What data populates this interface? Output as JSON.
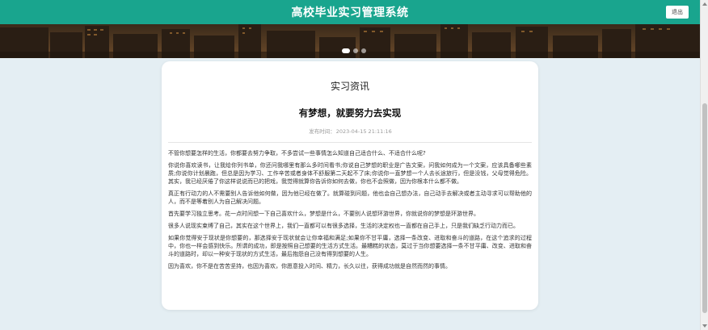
{
  "header": {
    "title": "高校毕业实习管理系统",
    "logout_label": "退出"
  },
  "section_title": "实习资讯",
  "article": {
    "title": "有梦想，就要努力去实现",
    "publish_label": "发布时间：",
    "publish_time": "2023-04-15 21:11:16",
    "paragraphs": [
      "不管你想要怎样的生活，你都要去努力争取，不多尝试一些事情怎么知道自己适合什么、不适合什么呢?",
      "你说你喜欢读书，让我给你列书单，你还问我哪里有那么多时间看书;你说自己梦想的职业是广告文案，问我如何成为一个文案，应该具备哪些素质;你说你计划晨跑，但总是因为学习、工作辛苦或者身体不舒服第二天起不了床;你说你一直梦想一个人去长途旅行，但是没钱，父母觉得危险。其实，我已经厌倦了你这样说说而已的把戏，我觉得就算你告诉你如何去做，你也不会照做，因为你根本什么都不做。",
      "真正有行动力的人不需要别人告诉他如何做，因为他已经在做了。就算碰到问题，他也会自己想办法，自己动手去解决或者主动寻求可以帮助他的人，而不是等着别人为自己解决问题。",
      "首先要学习独立思考。花一点时间想一下自己喜欢什么，梦想是什么，不要别人说想环游世界，你就说你的梦想是环游世界。",
      "很多人说现实束缚了自己，其实在这个世界上，我们一直都可以有很多选择，生活的决定权也一直都在自己手上，只是我们缺乏行动力而已。",
      "如果你觉得安于现状是你想要的，那选择安于现状就会让你幸福和满足;如果你不甘平庸，选择一条改变、进取和奋斗的道路，在这个追求的过程中，你也一样会感到快乐。所谓的成功，即是按照自己想要的生活方式生活。最糟糕的状态，莫过于当你想要选择一条不甘平庸、改变、进取和奋斗的道路时，却以一种安于现状的方式生活，最后抱怨自己没有得到想要的人生。",
      "因为喜欢，你不是在苦苦坚持，也因为喜欢，你愿意投入时间、精力，长久以往，获得成功就是自然而然的事情。"
    ]
  },
  "colors": {
    "header_bg": "#19a58e",
    "page_bg": "#e4eef3"
  },
  "icons": [
    "scroll-up-arrow-icon",
    "scroll-down-arrow-icon"
  ]
}
